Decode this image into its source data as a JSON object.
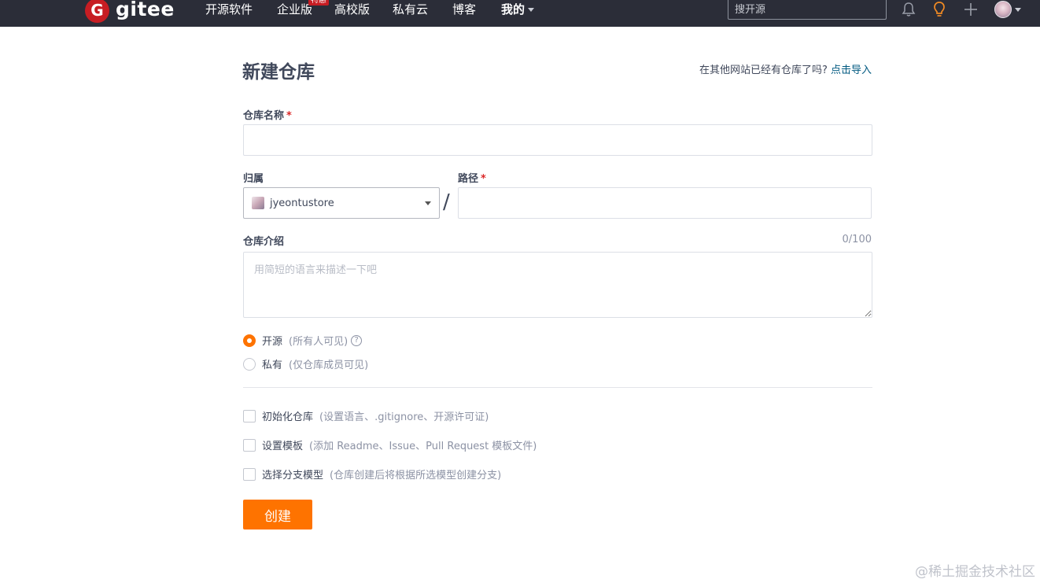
{
  "header": {
    "logo_letter": "G",
    "logo_text": "gitee",
    "nav": [
      {
        "label": "开源软件"
      },
      {
        "label": "企业版",
        "badge": "特惠"
      },
      {
        "label": "高校版"
      },
      {
        "label": "私有云"
      },
      {
        "label": "博客"
      },
      {
        "label": "我的"
      }
    ],
    "search_placeholder": "搜开源",
    "icons": [
      "bell-icon",
      "lightbulb-icon",
      "plus-icon",
      "user-avatar"
    ]
  },
  "page": {
    "title": "新建仓库",
    "import_prompt": "在其他网站已经有仓库了吗?",
    "import_link": "点击导入"
  },
  "form": {
    "repo_name_label": "仓库名称",
    "required_mark": "*",
    "repo_name_value": "",
    "owner_label": "归属",
    "owner_value": "jyeontustore",
    "slash": "/",
    "path_label": "路径",
    "path_value": "",
    "desc_label": "仓库介绍",
    "desc_counter": "0/100",
    "desc_placeholder": "用简短的语言来描述一下吧",
    "visibility": [
      {
        "label": "开源",
        "hint": "(所有人可见)",
        "checked": true,
        "help": "?"
      },
      {
        "label": "私有",
        "hint": "(仅仓库成员可见)",
        "checked": false
      }
    ],
    "options": [
      {
        "label": "初始化仓库",
        "hint": "(设置语言、.gitignore、开源许可证)",
        "checked": false
      },
      {
        "label": "设置模板",
        "hint": "(添加 Readme、Issue、Pull Request 模板文件)",
        "checked": false
      },
      {
        "label": "选择分支模型",
        "hint": "(仓库创建后将根据所选模型创建分支)",
        "checked": false
      }
    ],
    "submit_label": "创建"
  },
  "watermark": "@稀土掘金技术社区",
  "colors": {
    "nav_bg": "#2b2d38",
    "accent": "#fe7300",
    "link": "#005980",
    "logo_red": "#c71d23"
  }
}
